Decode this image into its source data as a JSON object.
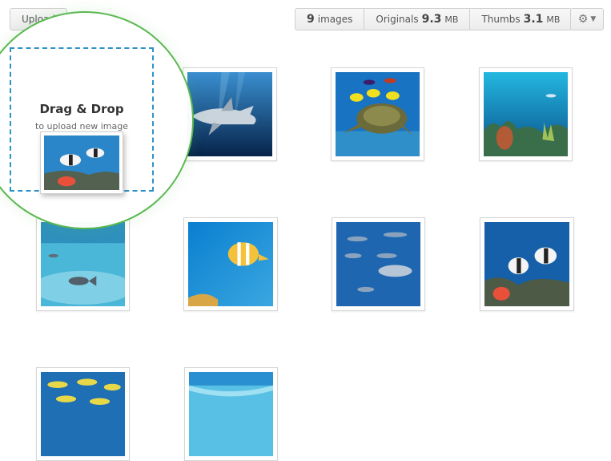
{
  "toolbar": {
    "upload_label": "Upload",
    "images_count": "9",
    "images_label": "images",
    "originals_label": "Originals",
    "originals_size": "9.3",
    "originals_unit": "MB",
    "thumbs_label": "Thumbs",
    "thumbs_size": "3.1",
    "thumbs_unit": "MB",
    "gear_icon": "gear-icon",
    "caret_icon": "chevron-down-icon"
  },
  "dropzone": {
    "title": "Drag & Drop",
    "subtitle": "to upload new image"
  },
  "colors": {
    "dropzone_border": "#2d93c6",
    "focus_ring": "#59b84f"
  },
  "gallery": [
    "shark",
    "sea-turtle",
    "coral-reef",
    "underwater-fish",
    "butterflyfish",
    "tuna-school",
    "bannerfish",
    "yellow-fish-school",
    "shallow-water"
  ]
}
